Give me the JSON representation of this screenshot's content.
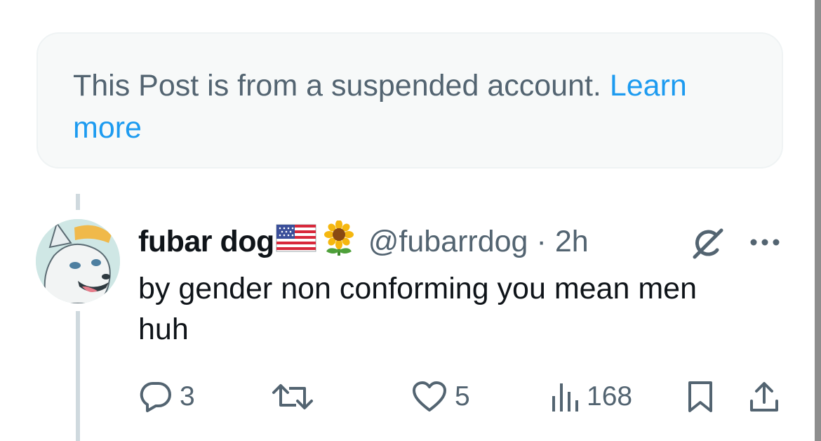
{
  "notice": {
    "text": "This Post is from a suspended account.",
    "link_label": "Learn more"
  },
  "post": {
    "author": {
      "display_name": "fubar dog",
      "name_emojis": [
        "flag-us",
        "sunflower"
      ],
      "handle": "@fubarrdog",
      "separator": "·",
      "time": "2h"
    },
    "text_line1": "by gender non conforming you mean men",
    "text_line2": "huh"
  },
  "actions": {
    "replies": "3",
    "reposts": "",
    "likes": "5",
    "views": "168"
  },
  "icons": {
    "reply": "reply-icon",
    "repost": "repost-icon",
    "like": "heart-icon",
    "views": "views-icon",
    "bookmark": "bookmark-icon",
    "share": "share-icon",
    "grok": "grok-icon",
    "more": "more-icon"
  },
  "colors": {
    "text": "#0f1419",
    "secondary": "#536471",
    "link": "#1d9bf0",
    "notice_bg": "#f7f9f9",
    "thread_line": "#cfd9de"
  }
}
